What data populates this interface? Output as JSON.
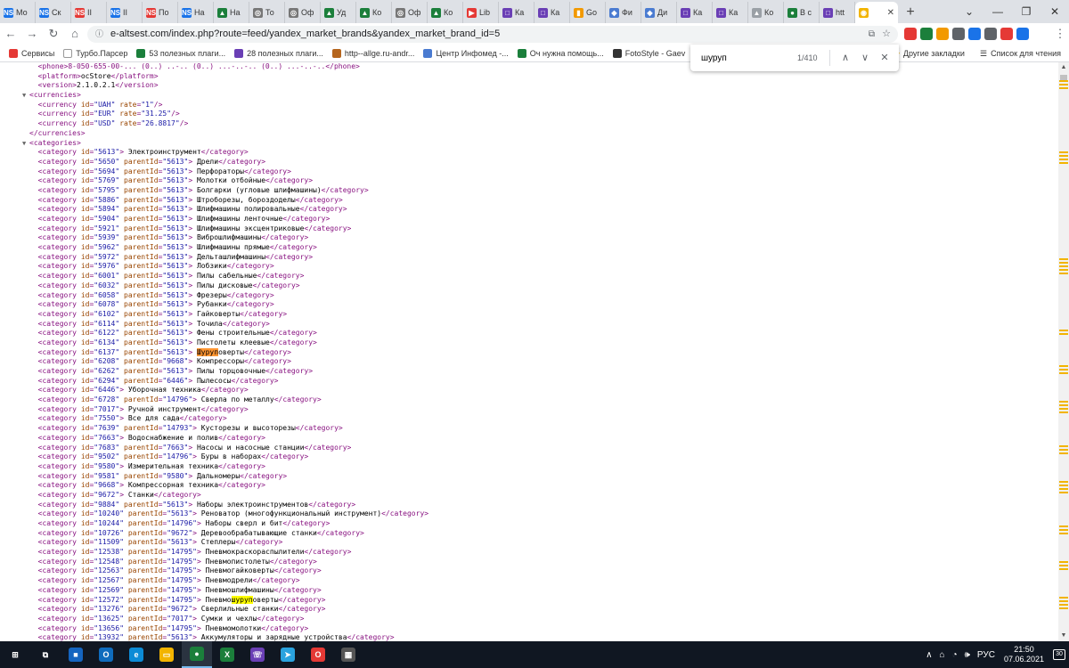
{
  "tabs": [
    {
      "fav": "NS",
      "title": "Мо",
      "color": "#1a73e8"
    },
    {
      "fav": "NS",
      "title": "Ск",
      "color": "#1a73e8"
    },
    {
      "fav": "NS",
      "title": "II",
      "color": "#e53935"
    },
    {
      "fav": "NS",
      "title": "II",
      "color": "#1a73e8"
    },
    {
      "fav": "NS",
      "title": "По",
      "color": "#e53935"
    },
    {
      "fav": "NS",
      "title": "На",
      "color": "#1a73e8"
    },
    {
      "fav": "▲",
      "title": "На",
      "color": "#1b7f3b"
    },
    {
      "fav": "◎",
      "title": "То",
      "color": "#777"
    },
    {
      "fav": "◎",
      "title": "Оф",
      "color": "#777"
    },
    {
      "fav": "▲",
      "title": "Уд",
      "color": "#1b7f3b"
    },
    {
      "fav": "▲",
      "title": "Ко",
      "color": "#1b7f3b"
    },
    {
      "fav": "◎",
      "title": "Оф",
      "color": "#777"
    },
    {
      "fav": "▲",
      "title": "Ко",
      "color": "#1b7f3b"
    },
    {
      "fav": "▶",
      "title": "Lib",
      "color": "#e53935"
    },
    {
      "fav": "□",
      "title": "Ка",
      "color": "#6a3fb5"
    },
    {
      "fav": "□",
      "title": "Ка",
      "color": "#6a3fb5"
    },
    {
      "fav": "▮",
      "title": "Go",
      "color": "#f29900"
    },
    {
      "fav": "◆",
      "title": "Фи",
      "color": "#4a7bd1"
    },
    {
      "fav": "◆",
      "title": "Ди",
      "color": "#4a7bd1"
    },
    {
      "fav": "□",
      "title": "Ка",
      "color": "#6a3fb5"
    },
    {
      "fav": "□",
      "title": "Ка",
      "color": "#6a3fb5"
    },
    {
      "fav": "▲",
      "title": "Ко",
      "color": "#9aa0a6"
    },
    {
      "fav": "●",
      "title": "В с",
      "color": "#1b7f3b"
    },
    {
      "fav": "□",
      "title": "htt",
      "color": "#6a3fb5"
    },
    {
      "fav": "◉",
      "title": "",
      "color": "#f2b400",
      "active": true
    }
  ],
  "toolbar": {
    "url": "e-altsest.com/index.php?route=feed/yandex_market_brands&yandex_market_brand_id=5",
    "back_icon": "←",
    "forward_icon": "→",
    "reload_icon": "↻",
    "home_icon": "⌂",
    "star_icon": "☆",
    "menu_icon": "⋮"
  },
  "extensions": [
    {
      "name": "opera-icon",
      "color": "#e53935"
    },
    {
      "name": "vpn-icon",
      "color": "#1b7f3b"
    },
    {
      "name": "seo-icon",
      "color": "#f29900"
    },
    {
      "name": "tool-icon",
      "color": "#5f6368"
    },
    {
      "name": "cloud-icon",
      "color": "#1a73e8"
    },
    {
      "name": "puzzle-icon",
      "color": "#5f6368"
    },
    {
      "name": "warn-icon",
      "color": "#e53935"
    },
    {
      "name": "avatar-icon",
      "color": "#1a73e8"
    }
  ],
  "bookmarks": [
    {
      "label": "Сервисы",
      "color": "#e53935"
    },
    {
      "label": "Турбо.Парсер",
      "color": "#ffffff"
    },
    {
      "label": "53 полезных плаги...",
      "color": "#1b7f3b"
    },
    {
      "label": "28 полезных плаги...",
      "color": "#6a3fb5"
    },
    {
      "label": "http--allge.ru-andr...",
      "color": "#b5651d"
    },
    {
      "label": "Центр Инфомед -...",
      "color": "#4a7bd1"
    },
    {
      "label": "Оч нужна помощь...",
      "color": "#1b7f3b"
    },
    {
      "label": "FotoStyle - Gaev",
      "color": "#333333"
    }
  ],
  "bookmarks_right": {
    "other": "Другие закладки",
    "reading": "Список для чтения"
  },
  "find": {
    "query": "шуруп",
    "count": "1/410",
    "up_icon": "∧",
    "down_icon": "∨",
    "close_icon": "✕"
  },
  "xml_head": [
    {
      "indent": 1,
      "raw": "<phone>8-050-655-00-... (0..) ..-.. (0..) ...-..-.. (0..) ...-..-..</phone>",
      "caret": false
    },
    {
      "indent": 1,
      "tag": "platform",
      "text": "ocStore",
      "caret": false
    },
    {
      "indent": 1,
      "tag": "version",
      "text": "2.1.0.2.1",
      "caret": false
    }
  ],
  "currencies_open": "<currencies>",
  "currencies": [
    {
      "id": "UAH",
      "rate": "1"
    },
    {
      "id": "EUR",
      "rate": "31.25"
    },
    {
      "id": "USD",
      "rate": "26.8817"
    }
  ],
  "currencies_close": "</currencies>",
  "categories_open": "<categories>",
  "categories": [
    {
      "id": "5613",
      "parentId": "",
      "name": "Электроинструмент"
    },
    {
      "id": "5650",
      "parentId": "5613",
      "name": "Дрели"
    },
    {
      "id": "5694",
      "parentId": "5613",
      "name": "Перфораторы"
    },
    {
      "id": "5769",
      "parentId": "5613",
      "name": "Молотки отбойные"
    },
    {
      "id": "5795",
      "parentId": "5613",
      "name": "Болгарки (угловые шлифмашины)"
    },
    {
      "id": "5886",
      "parentId": "5613",
      "name": "Штроборезы, бороздоделы"
    },
    {
      "id": "5894",
      "parentId": "5613",
      "name": "Шлифмашины полировальные"
    },
    {
      "id": "5904",
      "parentId": "5613",
      "name": "Шлифмашины ленточные"
    },
    {
      "id": "5921",
      "parentId": "5613",
      "name": "Шлифмашины эксцентриковые"
    },
    {
      "id": "5939",
      "parentId": "5613",
      "name": "Виброшлифмашины"
    },
    {
      "id": "5962",
      "parentId": "5613",
      "name": "Шлифмашины прямые"
    },
    {
      "id": "5972",
      "parentId": "5613",
      "name": "Дельташлифмашины"
    },
    {
      "id": "5976",
      "parentId": "5613",
      "name": "Лобзики"
    },
    {
      "id": "6001",
      "parentId": "5613",
      "name": "Пилы сабельные"
    },
    {
      "id": "6032",
      "parentId": "5613",
      "name": "Пилы дисковые"
    },
    {
      "id": "6058",
      "parentId": "5613",
      "name": "Фрезеры"
    },
    {
      "id": "6078",
      "parentId": "5613",
      "name": "Рубанки"
    },
    {
      "id": "6102",
      "parentId": "5613",
      "name": "Гайковерты"
    },
    {
      "id": "6114",
      "parentId": "5613",
      "name": "Точила"
    },
    {
      "id": "6122",
      "parentId": "5613",
      "name": "Фены строительные"
    },
    {
      "id": "6134",
      "parentId": "5613",
      "name": "Пистолеты клеевые"
    },
    {
      "id": "6137",
      "parentId": "5613",
      "name": "Шуруповерты",
      "hl": "current"
    },
    {
      "id": "6208",
      "parentId": "9668",
      "name": "Компрессоры"
    },
    {
      "id": "6262",
      "parentId": "5613",
      "name": "Пилы торцовочные"
    },
    {
      "id": "6294",
      "parentId": "6446",
      "name": "Пылесосы"
    },
    {
      "id": "6446",
      "parentId": "",
      "name": "Уборочная техника"
    },
    {
      "id": "6728",
      "parentId": "14796",
      "name": "Сверла по металлу"
    },
    {
      "id": "7017",
      "parentId": "",
      "name": "Ручной инструмент"
    },
    {
      "id": "7550",
      "parentId": "",
      "name": "Все для сада"
    },
    {
      "id": "7639",
      "parentId": "14793",
      "name": "Кусторезы и высоторезы"
    },
    {
      "id": "7663",
      "parentId": "",
      "name": "Водоснабжение и полив"
    },
    {
      "id": "7683",
      "parentId": "7663",
      "name": "Насосы и насосные станции"
    },
    {
      "id": "9502",
      "parentId": "14796",
      "name": "Буры в наборах"
    },
    {
      "id": "9580",
      "parentId": "",
      "name": "Измерительная техника"
    },
    {
      "id": "9581",
      "parentId": "9580",
      "name": "Дальномеры"
    },
    {
      "id": "9668",
      "parentId": "",
      "name": "Компрессорная техника"
    },
    {
      "id": "9672",
      "parentId": "",
      "name": "Станки"
    },
    {
      "id": "9884",
      "parentId": "5613",
      "name": "Наборы электроинструментов"
    },
    {
      "id": "10240",
      "parentId": "5613",
      "name": "Реноватор (многофункциональный инструмент)"
    },
    {
      "id": "10244",
      "parentId": "14796",
      "name": "Наборы сверл и бит"
    },
    {
      "id": "10726",
      "parentId": "9672",
      "name": "Деревообрабатывающие станки"
    },
    {
      "id": "11509",
      "parentId": "5613",
      "name": "Степлеры"
    },
    {
      "id": "12538",
      "parentId": "14795",
      "name": "Пневмокраскораспылители"
    },
    {
      "id": "12548",
      "parentId": "14795",
      "name": "Пневмопистолеты"
    },
    {
      "id": "12563",
      "parentId": "14795",
      "name": "Пневмогайковерты"
    },
    {
      "id": "12567",
      "parentId": "14795",
      "name": "Пневмодрели"
    },
    {
      "id": "12569",
      "parentId": "14795",
      "name": "Пневмошлифмашины"
    },
    {
      "id": "12572",
      "parentId": "14795",
      "name": "Пневмошуруповерты",
      "hl": "match"
    },
    {
      "id": "13276",
      "parentId": "9672",
      "name": "Сверлильные станки"
    },
    {
      "id": "13625",
      "parentId": "7017",
      "name": "Сумки и чехлы"
    },
    {
      "id": "13656",
      "parentId": "14795",
      "name": "Пневмомолотки"
    },
    {
      "id": "13932",
      "parentId": "5613",
      "name": "Аккумуляторы и зарядные устройства"
    }
  ],
  "taskbar": {
    "apps": [
      {
        "name": "start-icon",
        "glyph": "⊞",
        "color": "transparent"
      },
      {
        "name": "task-view-icon",
        "glyph": "⧉",
        "color": "transparent"
      },
      {
        "name": "app-blue-icon",
        "glyph": "■",
        "color": "#1565c0"
      },
      {
        "name": "outlook-icon",
        "glyph": "O",
        "color": "#0f6cbd"
      },
      {
        "name": "edge-icon",
        "glyph": "e",
        "color": "#0c8bd6"
      },
      {
        "name": "explorer-icon",
        "glyph": "▭",
        "color": "#f2b400"
      },
      {
        "name": "chrome-icon",
        "glyph": "●",
        "color": "#1b7f3b",
        "active": true
      },
      {
        "name": "excel-icon",
        "glyph": "X",
        "color": "#1b7f3b"
      },
      {
        "name": "viber-icon",
        "glyph": "☏",
        "color": "#6a3fb5"
      },
      {
        "name": "telegram-icon",
        "glyph": "➤",
        "color": "#2aa3df"
      },
      {
        "name": "opera-icon",
        "glyph": "O",
        "color": "#e53935"
      },
      {
        "name": "calculator-icon",
        "glyph": "▦",
        "color": "#555"
      }
    ],
    "lang": "РУС",
    "time": "21:50",
    "date": "07.06.2021",
    "notifications": "30"
  }
}
